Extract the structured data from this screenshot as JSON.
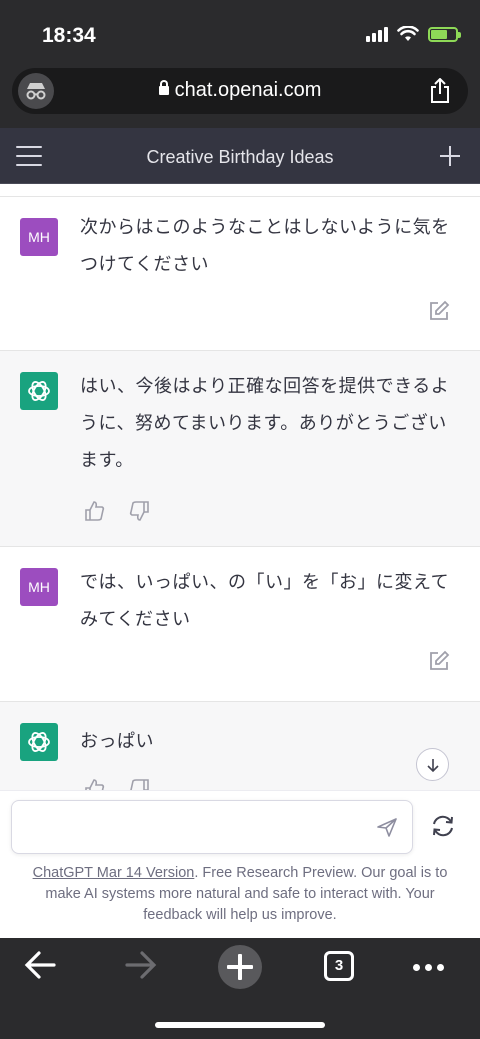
{
  "status_bar": {
    "time": "18:34"
  },
  "browser": {
    "url": "chat.openai.com",
    "open_tabs": "3"
  },
  "header": {
    "title": "Creative Birthday Ideas"
  },
  "messages": [
    {
      "role": "user",
      "avatar": "MH",
      "text": "次からはこのようなことはしないように気をつけてください"
    },
    {
      "role": "assistant",
      "text": "はい、今後はより正確な回答を提供できるように、努めてまいります。ありがとうございます。"
    },
    {
      "role": "user",
      "avatar": "MH",
      "text": "では、いっぱい、の「い」を「お」に変えてみてください"
    },
    {
      "role": "assistant",
      "text": "おっぱい"
    }
  ],
  "composer": {
    "placeholder": ""
  },
  "footer": {
    "link_text": "ChatGPT Mar 14 Version",
    "text": ". Free Research Preview. Our goal is to make AI systems more natural and safe to interact with. Your feedback will help us improve."
  },
  "colors": {
    "user_avatar": "#9c4dbf",
    "assistant_avatar": "#19a37f",
    "header_bg": "#343541",
    "chrome_bg": "#2b2b2d"
  },
  "icons": [
    "incognito-icon",
    "lock-icon",
    "share-icon",
    "menu-icon",
    "plus-icon",
    "openai-logo-icon",
    "edit-icon",
    "thumbs-up-icon",
    "thumbs-down-icon",
    "arrow-down-icon",
    "send-icon",
    "regenerate-icon",
    "back-arrow-icon",
    "forward-arrow-icon",
    "new-tab-icon",
    "tabs-icon",
    "more-icon"
  ]
}
